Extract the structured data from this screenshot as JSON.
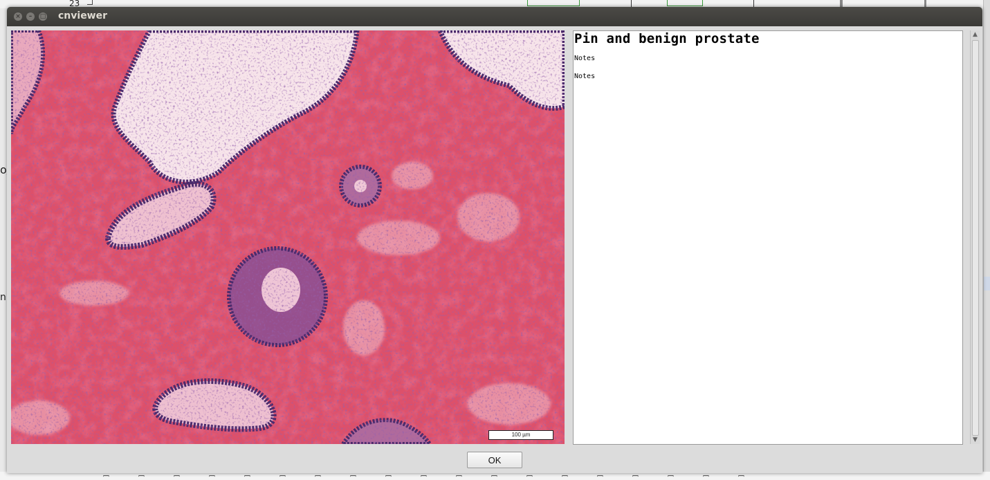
{
  "background_app": {
    "row_label": "23",
    "left_fragment_1": "o/",
    "left_fragment_2": "n"
  },
  "window": {
    "title": "cnviewer",
    "close_glyph": "×",
    "minimize_glyph": "–",
    "maximize_glyph": "□"
  },
  "image": {
    "description_icon": "histology-micrograph",
    "scale_bar_label": "100 µm"
  },
  "notes": {
    "heading": "Pin and benign prostate",
    "lines": [
      "Notes",
      "Notes"
    ]
  },
  "scrollbar": {
    "up_arrow": "▲",
    "down_arrow": "▼"
  },
  "buttons": {
    "ok_label": "OK"
  },
  "colors": {
    "titlebar": "#3f3e3b",
    "stroma": "#dc4f68",
    "nuclei": "#4a2a6b"
  }
}
